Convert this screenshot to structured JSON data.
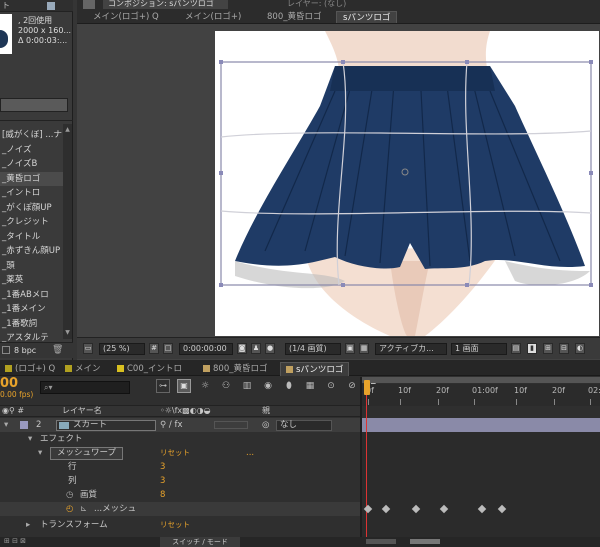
{
  "project_panel": {
    "tab_label": "ト",
    "comp_info": {
      "line1": ", 2回使用",
      "line2": "2000 x 160...",
      "line3": "Δ 0:00:03:..."
    },
    "items": [
      "[威がくぼ] ...ナ",
      "_ノイズ",
      "_ノイズB",
      "_黄昏ロゴ",
      "_イントロ",
      "_がくぽ顔UP",
      "_クレジット",
      "_タイトル",
      "_赤ずきん顔UP",
      "_頭",
      "_薬英",
      "_1番ABメロ",
      "_1番メイン",
      "_1番歌詞",
      "_アスタルテ"
    ],
    "bit_depth": "8 bpc"
  },
  "viewer": {
    "composition_tab": "コンポジション: sパンツロゴ",
    "layer_tab": "レイヤー: (なし)",
    "breadcrumbs": [
      "メイン(ロゴ+) Q",
      "メイン(ロゴ+)",
      "800_黄昏ロゴ",
      "sパンツロゴ"
    ],
    "zoom": "(25 %)",
    "timecode": "0:00:00:00",
    "resolution": "(1/4 画質)",
    "camera": "アクティブカ...",
    "views": "1 画面"
  },
  "timeline": {
    "tabs": [
      {
        "label": "(ロゴ+) Q",
        "color": "#b0a020"
      },
      {
        "label": "メイン",
        "color": "#b0a020"
      },
      {
        "label": "C00_イントロ",
        "color": "#d8c020"
      },
      {
        "label": "800_黄昏ロゴ",
        "color": "#c0a060"
      },
      {
        "label": "sパンツロゴ",
        "color": "#c0a060"
      }
    ],
    "current_time": "00",
    "fps": "0.00 fps)",
    "search_placeholder": "",
    "column_layer_name": "レイヤー名",
    "column_parent": "親",
    "layer": {
      "num": "2",
      "name": "スカート",
      "parent": "なし"
    },
    "rows": {
      "effect": "エフェクト",
      "mesh_warp": "メッシュワープ",
      "reset": "リセット",
      "dots": "...",
      "rows_label": "行",
      "rows_value": "3",
      "cols_label": "列",
      "cols_value": "3",
      "quality_label": "画質",
      "quality_value": "8",
      "mesh_label": "...メッシュ",
      "transform": "トランスフォーム",
      "transform_reset": "リセット"
    },
    "ruler_ticks": [
      "0f",
      "10f",
      "20f",
      "01:00f",
      "10f",
      "20f",
      "02:"
    ],
    "switch_mode": "スイッチ / モード"
  }
}
